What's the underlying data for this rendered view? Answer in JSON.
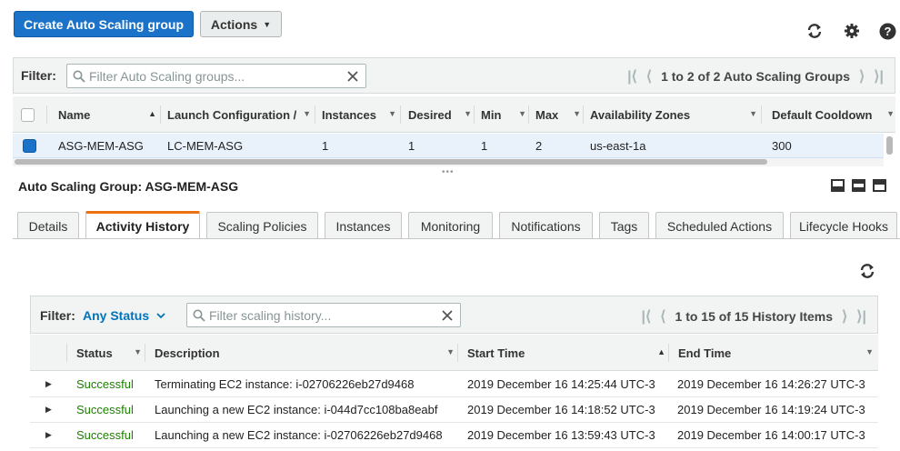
{
  "toolbar": {
    "create_label": "Create Auto Scaling group",
    "actions_label": "Actions"
  },
  "filter": {
    "label": "Filter:",
    "placeholder": "Filter Auto Scaling groups...",
    "pager_text": "1 to 2 of 2 Auto Scaling Groups"
  },
  "asg_table": {
    "columns": [
      "Name",
      "Launch Configuration /",
      "Instances",
      "Desired",
      "Min",
      "Max",
      "Availability Zones",
      "Default Cooldown"
    ],
    "rows": [
      {
        "name": "ASG-MEM-ASG",
        "launch_config": "LC-MEM-ASG",
        "instances": "1",
        "desired": "1",
        "min": "1",
        "max": "2",
        "zones": "us-east-1a",
        "cooldown": "300"
      }
    ]
  },
  "detail": {
    "title": "Auto Scaling Group: ASG-MEM-ASG"
  },
  "tabs": [
    "Details",
    "Activity History",
    "Scaling Policies",
    "Instances",
    "Monitoring",
    "Notifications",
    "Tags",
    "Scheduled Actions",
    "Lifecycle Hooks"
  ],
  "history": {
    "filter_label": "Filter:",
    "status_filter": "Any Status",
    "search_placeholder": "Filter scaling history...",
    "pager_text": "1 to 15 of 15 History Items",
    "columns": [
      "Status",
      "Description",
      "Start Time",
      "End Time"
    ],
    "rows": [
      {
        "status": "Successful",
        "description": "Terminating EC2 instance: i-02706226eb27d9468",
        "start": "2019 December 16 14:25:44 UTC-3",
        "end": "2019 December 16 14:26:27 UTC-3"
      },
      {
        "status": "Successful",
        "description": "Launching a new EC2 instance: i-044d7cc108ba8eabf",
        "start": "2019 December 16 14:18:52 UTC-3",
        "end": "2019 December 16 14:19:24 UTC-3"
      },
      {
        "status": "Successful",
        "description": "Launching a new EC2 instance: i-02706226eb27d9468",
        "start": "2019 December 16 13:59:43 UTC-3",
        "end": "2019 December 16 14:00:17 UTC-3"
      }
    ]
  },
  "colors": {
    "primary": "#1a73c9",
    "active_tab": "#ec7211",
    "success": "#1d8102",
    "link": "#0073bb"
  },
  "icons": [
    "refresh-icon",
    "gear-icon",
    "help-icon",
    "search-icon",
    "clear-icon",
    "pager-first-icon",
    "pager-prev-icon",
    "pager-next-icon",
    "pager-last-icon",
    "sort-asc-icon",
    "layout-icon"
  ]
}
